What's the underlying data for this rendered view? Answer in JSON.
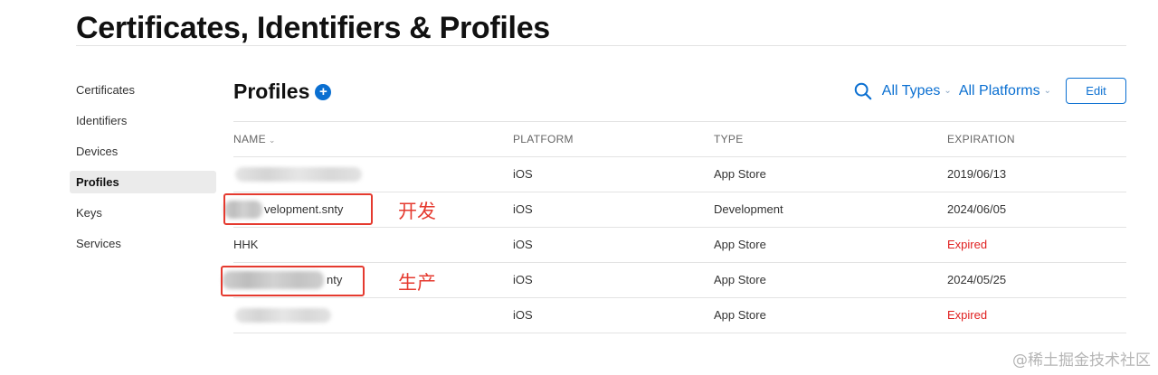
{
  "page": {
    "title": "Certificates, Identifiers & Profiles"
  },
  "sidebar": {
    "items": [
      {
        "label": "Certificates"
      },
      {
        "label": "Identifiers"
      },
      {
        "label": "Devices"
      },
      {
        "label": "Profiles",
        "active": true
      },
      {
        "label": "Keys"
      },
      {
        "label": "Services"
      }
    ]
  },
  "section": {
    "title": "Profiles",
    "add_icon": "plus-circle-icon"
  },
  "toolbar": {
    "search_icon": "search-icon",
    "filter_types": "All Types",
    "filter_platforms": "All Platforms",
    "edit_label": "Edit"
  },
  "table": {
    "headers": {
      "name": "NAME",
      "platform": "PLATFORM",
      "type": "TYPE",
      "expiration": "EXPIRATION"
    },
    "rows": [
      {
        "name": "",
        "platform": "iOS",
        "type": "App Store",
        "expiration": "2019/06/13",
        "expired": false
      },
      {
        "name": "velopment.snty",
        "platform": "iOS",
        "type": "Development",
        "expiration": "2024/06/05",
        "expired": false
      },
      {
        "name": "HHK",
        "platform": "iOS",
        "type": "App Store",
        "expiration": "Expired",
        "expired": true
      },
      {
        "name": "nty",
        "platform": "iOS",
        "type": "App Store",
        "expiration": "2024/05/25",
        "expired": false
      },
      {
        "name": "",
        "platform": "iOS",
        "type": "App Store",
        "expiration": "Expired",
        "expired": true
      }
    ]
  },
  "annotations": {
    "dev": "开发",
    "prod": "生产"
  },
  "watermark": "@稀土掘金技术社区",
  "colors": {
    "accent": "#0a6fd1",
    "expired": "#e02020",
    "annotation": "#e53a2f"
  }
}
